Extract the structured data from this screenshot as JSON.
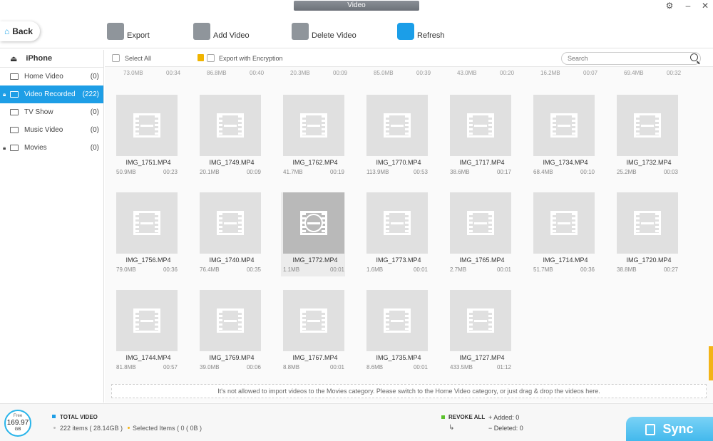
{
  "window": {
    "title": "Video",
    "settings_icon": "gear-icon",
    "minimize": "–",
    "close": "✕"
  },
  "toolbar": {
    "back_label": "Back",
    "export_label": "Export",
    "add_label": "Add Video",
    "delete_label": "Delete Video",
    "refresh_label": "Refresh"
  },
  "sidebar": {
    "device": "iPhone",
    "items": [
      {
        "label": "Home Video",
        "count": "(0)",
        "icon": "monitor-icon"
      },
      {
        "label": "Video Recorded",
        "count": "(222)",
        "icon": "camera-icon"
      },
      {
        "label": "TV Show",
        "count": "(0)",
        "icon": "tv-icon"
      },
      {
        "label": "Music Video",
        "count": "(0)",
        "icon": "music-icon"
      },
      {
        "label": "Movies",
        "count": "(0)",
        "icon": "film-icon"
      }
    ]
  },
  "filters": {
    "select_all": "Select All",
    "export_encryption": "Export with Encryption",
    "search_placeholder": "Search"
  },
  "top_row_meta": [
    {
      "size": "73.0MB",
      "dur": "00:34"
    },
    {
      "size": "86.8MB",
      "dur": "00:40"
    },
    {
      "size": "20.3MB",
      "dur": "00:09"
    },
    {
      "size": "85.0MB",
      "dur": "00:39"
    },
    {
      "size": "43.0MB",
      "dur": "00:20"
    },
    {
      "size": "16.2MB",
      "dur": "00:07"
    },
    {
      "size": "69.4MB",
      "dur": "00:32"
    }
  ],
  "rows": [
    [
      {
        "name": "IMG_1751.MP4",
        "size": "50.9MB",
        "dur": "00:23"
      },
      {
        "name": "IMG_1749.MP4",
        "size": "20.1MB",
        "dur": "00:09"
      },
      {
        "name": "IMG_1762.MP4",
        "size": "41.7MB",
        "dur": "00:19"
      },
      {
        "name": "IMG_1770.MP4",
        "size": "113.9MB",
        "dur": "00:53"
      },
      {
        "name": "IMG_1717.MP4",
        "size": "38.6MB",
        "dur": "00:17"
      },
      {
        "name": "IMG_1734.MP4",
        "size": "68.4MB",
        "dur": "00:10"
      },
      {
        "name": "IMG_1732.MP4",
        "size": "25.2MB",
        "dur": "00:03"
      }
    ],
    [
      {
        "name": "IMG_1756.MP4",
        "size": "79.0MB",
        "dur": "00:36"
      },
      {
        "name": "IMG_1740.MP4",
        "size": "76.4MB",
        "dur": "00:35"
      },
      {
        "name": "IMG_1772.MP4",
        "size": "1.1MB",
        "dur": "00:01"
      },
      {
        "name": "IMG_1773.MP4",
        "size": "1.6MB",
        "dur": "00:01"
      },
      {
        "name": "IMG_1765.MP4",
        "size": "2.7MB",
        "dur": "00:01"
      },
      {
        "name": "IMG_1714.MP4",
        "size": "51.7MB",
        "dur": "00:36"
      },
      {
        "name": "IMG_1720.MP4",
        "size": "38.8MB",
        "dur": "00:27"
      }
    ],
    [
      {
        "name": "IMG_1744.MP4",
        "size": "81.8MB",
        "dur": "00:57"
      },
      {
        "name": "IMG_1769.MP4",
        "size": "39.0MB",
        "dur": "00:06"
      },
      {
        "name": "IMG_1767.MP4",
        "size": "8.8MB",
        "dur": "00:01"
      },
      {
        "name": "IMG_1735.MP4",
        "size": "8.6MB",
        "dur": "00:01"
      },
      {
        "name": "IMG_1727.MP4",
        "size": "433.5MB",
        "dur": "01:12"
      }
    ]
  ],
  "hint": "It's not allowed to  import videos to the Movies category.  Please switch to the Home Video category, or just drag & drop the videos here.",
  "footer": {
    "free_label": "Free",
    "free_value": "169.97",
    "free_unit": "GB",
    "total_label": "TOTAL VIDEO",
    "items_label": "222 items ( 28.14GB )",
    "selected_label": "Selected Items ( 0 ( 0B )",
    "revoke_label": "REVOKE ALL",
    "revoke_arrow": "↳",
    "added_label": "+  Added: 0",
    "deleted_label": "−  Deleted: 0",
    "sync_label": "Sync"
  },
  "colors": {
    "accent": "#1e9ee6",
    "highlight": "#f3b417",
    "revoke": "#5ac12b",
    "sync": "#41b8ec"
  }
}
